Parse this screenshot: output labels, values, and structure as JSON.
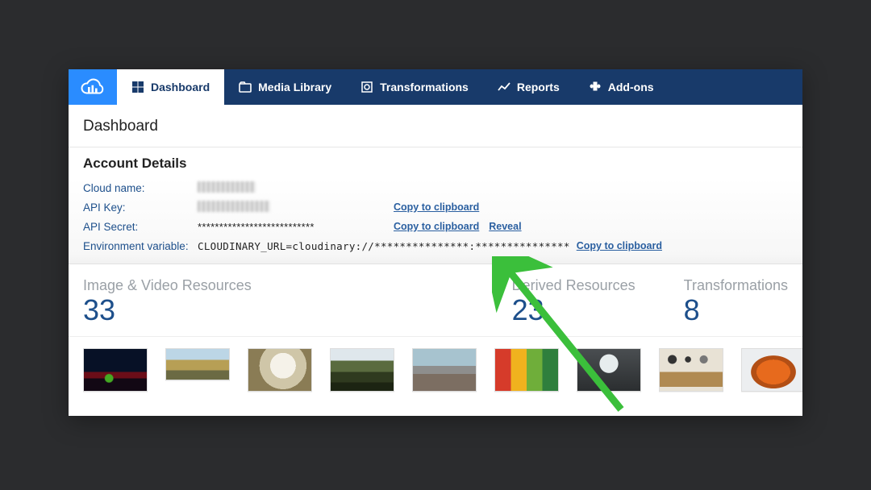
{
  "nav": {
    "items": [
      {
        "label": "Dashboard",
        "icon": "dashboard-icon",
        "active": true
      },
      {
        "label": "Media Library",
        "icon": "media-library-icon",
        "active": false
      },
      {
        "label": "Transformations",
        "icon": "transformations-icon",
        "active": false
      },
      {
        "label": "Reports",
        "icon": "reports-icon",
        "active": false
      },
      {
        "label": "Add-ons",
        "icon": "addons-icon",
        "active": false
      }
    ]
  },
  "page": {
    "title": "Dashboard",
    "section_title": "Account Details"
  },
  "account": {
    "cloud_name_label": "Cloud name:",
    "cloud_name_value_obscured": true,
    "api_key_label": "API Key:",
    "api_key_value_obscured": true,
    "api_key_copy": "Copy to clipboard",
    "api_secret_label": "API Secret:",
    "api_secret_value": "***************************",
    "api_secret_copy": "Copy to clipboard",
    "api_secret_reveal": "Reveal",
    "env_var_label": "Environment variable:",
    "env_var_value": "CLOUDINARY_URL=cloudinary://***************:***************",
    "env_var_copy": "Copy to clipboard"
  },
  "stats": {
    "resources_title": "Image & Video Resources",
    "resources_value": "33",
    "derived_title": "Derived Resources",
    "derived_value": "23",
    "transformations_title": "Transformations",
    "transformations_value": "8"
  },
  "thumbnails": [
    "city-lights",
    "landscape",
    "white-cat",
    "forest",
    "group-photo",
    "spices-grid",
    "group-photo-bw",
    "flat-lay-items",
    "orange-bag"
  ],
  "annotation": {
    "type": "arrow",
    "color": "#3bbf3b",
    "points_to": "env-var-copy-link"
  }
}
